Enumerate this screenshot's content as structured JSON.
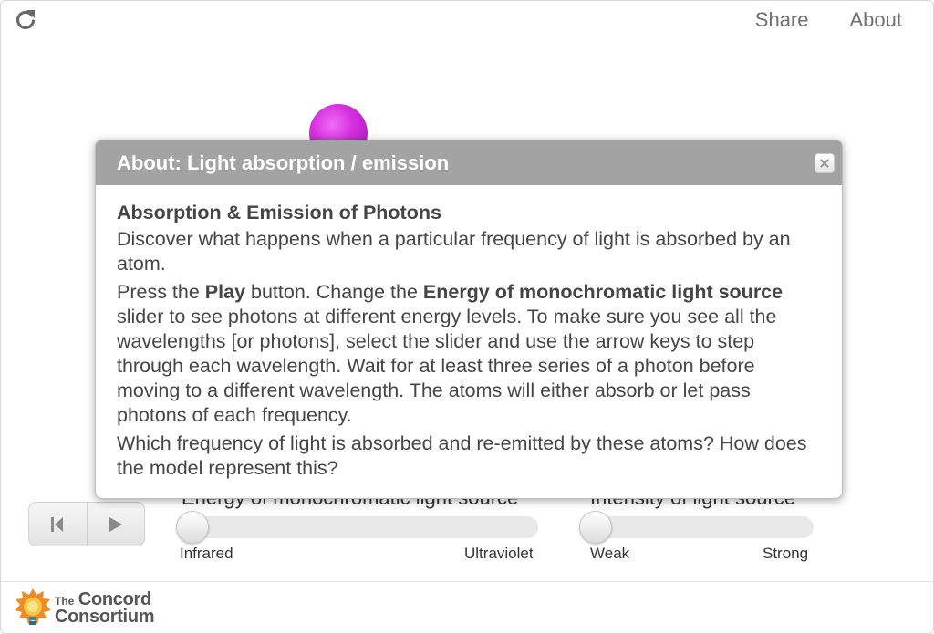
{
  "topnav": {
    "share": "Share",
    "about": "About"
  },
  "controls": {
    "energy": {
      "title": "Energy of monochromatic light source",
      "min_label": "Infrared",
      "max_label": "Ultraviolet",
      "value": 0
    },
    "intensity": {
      "title": "Intensity of light source",
      "min_label": "Weak",
      "max_label": "Strong",
      "value": 0
    }
  },
  "logo": {
    "the": "The",
    "line1": "Concord",
    "line2": "Consortium"
  },
  "dialog": {
    "title": "About: Light absorption / emission",
    "heading": "Absorption & Emission of Photons",
    "p1": "Discover what happens when a particular frequency of light is absorbed by an atom.",
    "p2": {
      "t1": "Press the ",
      "b1": "Play",
      "t2": " button. Change the ",
      "b2": "Energy of monochromatic light source",
      "t3": " slider to see photons at different energy levels. To make sure you see all the wavelengths [or photons], select the slider and use the arrow keys to step through each wavelength. Wait for at least three series of a photon before moving to a different wavelength. The atoms will either absorb or let pass photons of each frequency."
    },
    "p3": "Which frequency of light is absorbed and re-emitted by these atoms? How does the model represent this?"
  },
  "icons": {
    "reload": "reload-icon",
    "reset": "skip-back-icon",
    "play": "play-icon",
    "close": "close-icon",
    "logo": "lightbulb-icon"
  },
  "colors": {
    "atom": "#d52fe0",
    "dialog_header": "#a3a3a3",
    "logo_orange": "#f08a24"
  }
}
